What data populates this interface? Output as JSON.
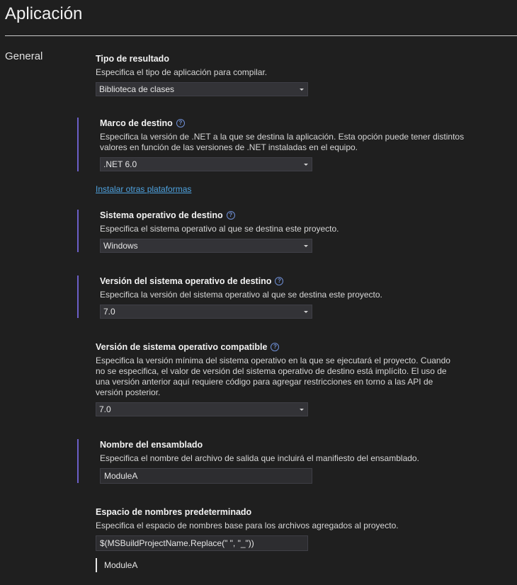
{
  "page": {
    "title": "Aplicación"
  },
  "nav": {
    "general": "General"
  },
  "output_type": {
    "label": "Tipo de resultado",
    "description": "Especifica el tipo de aplicación para compilar.",
    "value": "Biblioteca de clases"
  },
  "target_framework": {
    "label": "Marco de destino",
    "description_line1": "Especifica la versión de .NET a la que se destina la aplicación. Esta opción puede tener distintos",
    "description_line2": "valores en función de las versiones de .NET instaladas en el equipo.",
    "value": ".NET 6.0",
    "install_link": "Instalar otras plataformas"
  },
  "target_os": {
    "label": "Sistema operativo de destino",
    "description": "Especifica el sistema operativo al que se destina este proyecto.",
    "value": "Windows"
  },
  "target_os_version": {
    "label": "Versión del sistema operativo de destino",
    "description": "Especifica la versión del sistema operativo al que se destina este proyecto.",
    "value": "7.0"
  },
  "supported_os_version": {
    "label": "Versión de sistema operativo compatible",
    "description_line1": "Especifica la versión mínima del sistema operativo en la que se ejecutará el proyecto. Cuando",
    "description_line2": "no se especifica, el valor de versión del sistema operativo de destino está implícito. El uso de",
    "description_line3": "una versión anterior aquí requiere código para agregar restricciones en torno a las API de",
    "description_line4": "versión posterior.",
    "value": "7.0"
  },
  "assembly_name": {
    "label": "Nombre del ensamblado",
    "description": "Especifica el nombre del archivo de salida que incluirá el manifiesto del ensamblado.",
    "value": "ModuleA"
  },
  "default_namespace": {
    "label": "Espacio de nombres predeterminado",
    "description": "Especifica el espacio de nombres base para los archivos agregados al proyecto.",
    "value": "$(MSBuildProjectName.Replace(\" \", \"_\"))",
    "evaluated": "ModuleA"
  },
  "icons": {
    "help": "?"
  }
}
